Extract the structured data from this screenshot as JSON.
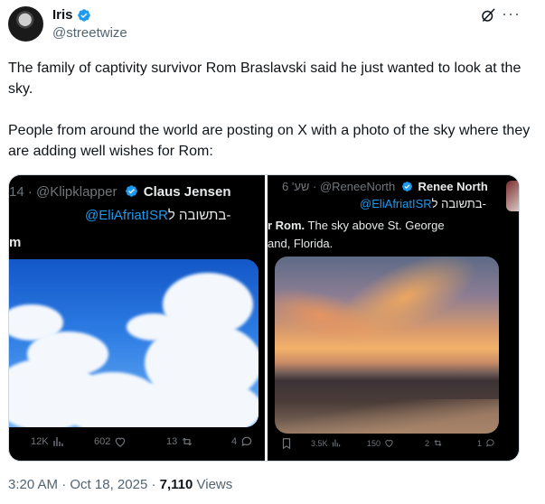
{
  "author": {
    "display_name": "Iris",
    "handle": "@streetwize"
  },
  "tweet": {
    "paragraph_1": "The family of captivity survivor Rom Braslavski said he just wanted to look at the sky.",
    "paragraph_2": "People from around the world are posting on  X with a photo of the sky where they are adding well wishes for Rom:"
  },
  "left_screenshot": {
    "meta_prefix": "14 · @Klipklapper",
    "author_name": "Claus Jensen",
    "reply_to_label": "בתשובה ל-",
    "reply_to_handle": "@EliAfriatISR",
    "text_fragment": "m",
    "stats": {
      "views": "12K",
      "likes": "602",
      "reposts": "13",
      "replies": "4"
    }
  },
  "right_screenshot": {
    "meta_prefix": "שע' 6 · @ReneeNorth",
    "author_name": "Renee North",
    "reply_to_label": "בתשובה ל-",
    "reply_to_handle": "@EliAfriatISR",
    "text_line_1_bold": "r Rom.",
    "text_line_1_rest": " The sky above St. George",
    "text_line_2": "and, Florida.",
    "stats": {
      "views": "3.5K",
      "likes": "150",
      "reposts": "2",
      "replies": "1"
    }
  },
  "footer": {
    "time": "3:20 AM",
    "sep_1": " · ",
    "date": "Oct 18, 2025",
    "sep_2": " · ",
    "views_count": "7,110",
    "views_label": " Views"
  },
  "colors": {
    "verified_blue": "#1d9bf0",
    "link_blue": "#1d9bf0",
    "text_primary": "#0f1419",
    "text_secondary": "#536471"
  },
  "icons": [
    "verified-badge-icon",
    "grok-icon",
    "more-icon",
    "views-icon",
    "like-icon",
    "repost-icon",
    "reply-icon",
    "bookmark-icon"
  ]
}
